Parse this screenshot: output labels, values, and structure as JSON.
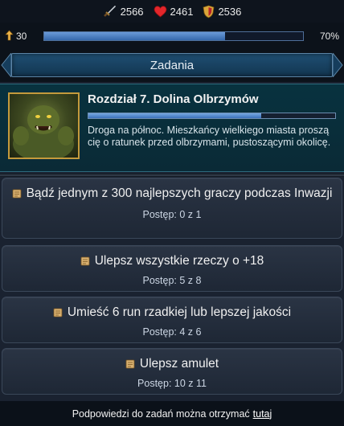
{
  "stats": {
    "attack": "2566",
    "health": "2461",
    "defense": "2536",
    "icons": [
      "sword-icon",
      "heart-icon",
      "shield-icon"
    ]
  },
  "level": {
    "value": "30",
    "xp_percent_label": "70%",
    "xp_fraction": 0.7
  },
  "header": {
    "title": "Zadania"
  },
  "chapter": {
    "title": "Rozdział 7. Dolina Olbrzymów",
    "description": "Droga na północ. Mieszkańcy wielkiego miasta proszą cię o ratunek przed olbrzymami, pustoszącymi okolicę.",
    "progress_fraction": 0.7
  },
  "quests": [
    {
      "title": "Bądź jednym z 300 najlepszych graczy podczas Inwazji",
      "progress": "Postęp: 0 z 1"
    },
    {
      "title": "Ulepsz wszystkie rzeczy o +18",
      "progress": "Postęp: 5 z 8"
    },
    {
      "title": "Umieść 6 run rzadkiej lub lepszej jakości",
      "progress": "Postęp: 4 z 6"
    },
    {
      "title": "Ulepsz amulet",
      "progress": "Postęp: 10 z 11"
    }
  ],
  "footer": {
    "text": "Podpowiedzi do zadań można otrzymać",
    "link": "tutaj"
  },
  "colors": {
    "xp_fill": "#3669ad",
    "banner": "#1f4f73",
    "chapter_bg": "#08323f",
    "frame_gold": "#c49a3c"
  }
}
